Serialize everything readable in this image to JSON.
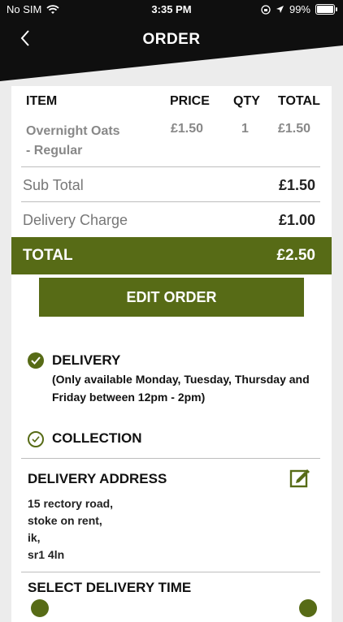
{
  "status_bar": {
    "carrier": "No SIM",
    "time": "3:35 PM",
    "battery": "99%",
    "battery_level": 0.99
  },
  "nav": {
    "title": "ORDER"
  },
  "table": {
    "headers": [
      "ITEM",
      "PRICE",
      "QTY",
      "TOTAL"
    ],
    "rows": [
      {
        "item_line1": "Overnight Oats",
        "item_line2": "- Regular",
        "price": "£1.50",
        "qty": "1",
        "total": "£1.50"
      }
    ]
  },
  "summary": {
    "subtotal_label": "Sub Total",
    "subtotal_value": "£1.50",
    "delivery_label": "Delivery Charge",
    "delivery_value": "£1.00",
    "total_label": "TOTAL",
    "total_value": "£2.50"
  },
  "edit_button": "EDIT ORDER",
  "options": {
    "delivery_label": "DELIVERY",
    "delivery_note_line1": "(Only available Monday, Tuesday, Thursday and",
    "delivery_note_line2": "Friday between 12pm - 2pm)",
    "collection_label": "COLLECTION"
  },
  "address": {
    "title": "DELIVERY ADDRESS",
    "lines": [
      "15 rectory road,",
      "stoke on rent,",
      "ik,",
      "sr1 4ln"
    ]
  },
  "delivery_time": {
    "title": "SELECT DELIVERY TIME"
  },
  "colors": {
    "accent": "#576b16",
    "header": "#0f0f0f"
  }
}
